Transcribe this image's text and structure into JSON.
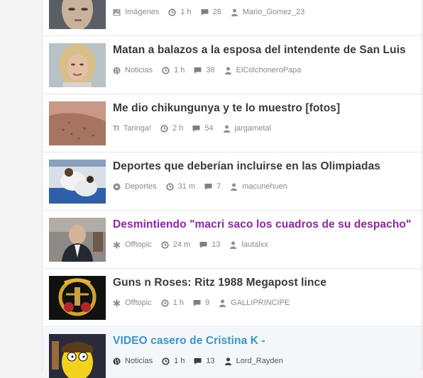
{
  "posts": [
    {
      "title": "",
      "category": "Imágenes",
      "category_icon": "image-icon",
      "time": "1 h",
      "comments": "28",
      "author": "Mario_Gomez_23"
    },
    {
      "title": "Matan a balazos a la esposa del intendente de San Luis",
      "category": "Noticias",
      "category_icon": "globe-icon",
      "time": "1 h",
      "comments": "38",
      "author": "ElColchoneroPapa"
    },
    {
      "title": "Me dio chikungunya y te lo muestro [fotos]",
      "category": "Taringa!",
      "category_icon": "taringa-icon",
      "category_glyph": "TI",
      "time": "2 h",
      "comments": "54",
      "author": "jargametal"
    },
    {
      "title": "Deportes que deberían incluirse en las Olimpiadas",
      "category": "Deportes",
      "category_icon": "soccer-ball-icon",
      "time": "31 m",
      "comments": "7",
      "author": "macunehuen"
    },
    {
      "title": "Desmintiendo \"macri saco los cuadros de su despacho\"",
      "category": "Offtopic",
      "category_icon": "asterisk-icon",
      "time": "24 m",
      "comments": "13",
      "author": "lautalxx"
    },
    {
      "title": "Guns n Roses: Ritz 1988 Megapost lince",
      "category": "Offtopic",
      "category_icon": "asterisk-icon",
      "time": "1 h",
      "comments": "9",
      "author": "GALLIPRINCIPE"
    },
    {
      "title": "VIDEO casero de Cristina K -",
      "category": "Noticias",
      "category_icon": "globe-icon",
      "time": "1 h",
      "comments": "13",
      "author": "Lord_Rayden"
    }
  ],
  "colors": {
    "visited_link": "#9a1fb3",
    "hover_link": "#3794d5",
    "text": "#3a3a3a",
    "meta": "#8a8a8a"
  }
}
